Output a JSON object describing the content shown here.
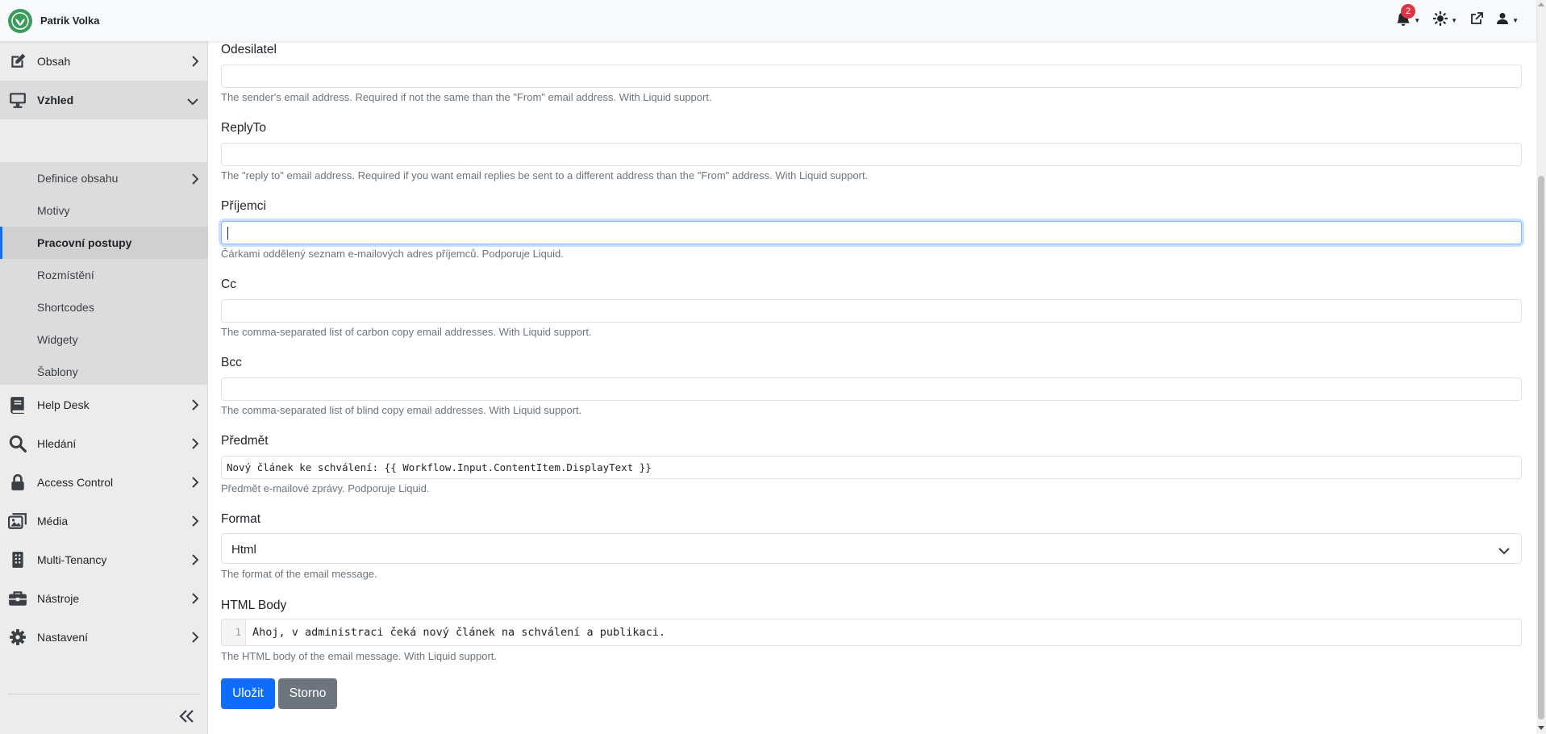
{
  "header": {
    "brand_name": "Patrik Volka",
    "notification_count": "2",
    "icons": [
      "bell-icon",
      "theme-sun-icon",
      "external-link-icon",
      "user-icon"
    ],
    "brand_color": "#3a9b5c"
  },
  "sidebar": {
    "items": [
      {
        "label": "Obsah",
        "icon": "edit-icon"
      },
      {
        "label": "Vzhled",
        "icon": "monitor-icon"
      },
      {
        "label": "Help Desk",
        "icon": "book-icon"
      },
      {
        "label": "Hledání",
        "icon": "search-icon"
      },
      {
        "label": "Access Control",
        "icon": "lock-icon"
      },
      {
        "label": "Média",
        "icon": "images-icon"
      },
      {
        "label": "Multi-Tenancy",
        "icon": "building-icon"
      },
      {
        "label": "Nástroje",
        "icon": "toolbox-icon"
      },
      {
        "label": "Nastavení",
        "icon": "cog-icon"
      }
    ],
    "sub_items": [
      {
        "label": "Definice obsahu"
      },
      {
        "label": "Motivy"
      },
      {
        "label": "Pracovní postupy"
      },
      {
        "label": "Rozmístění"
      },
      {
        "label": "Shortcodes"
      },
      {
        "label": "Widgety"
      },
      {
        "label": "Šablony"
      }
    ],
    "collapse_icon": "double-chevron-left-icon"
  },
  "form": {
    "sender": {
      "label": "Odesilatel",
      "value": "",
      "help": "The sender's email address. Required if not the same than the \"From\" email address. With Liquid support."
    },
    "replyto": {
      "label": "ReplyTo",
      "value": "",
      "help": "The \"reply to\" email address. Required if you want email replies be sent to a different address than the \"From\" address. With Liquid support."
    },
    "recipients": {
      "label": "Příjemci",
      "value": "",
      "help": "Čárkami oddělený seznam e-mailových adres příjemců. Podporuje Liquid."
    },
    "cc": {
      "label": "Cc",
      "value": "",
      "help": "The comma-separated list of carbon copy email addresses. With Liquid support."
    },
    "bcc": {
      "label": "Bcc",
      "value": "",
      "help": "The comma-separated list of blind copy email addresses. With Liquid support."
    },
    "subject": {
      "label": "Předmět",
      "value": "Nový článek ke schválení: {{ Workflow.Input.ContentItem.DisplayText }}",
      "help": "Předmět e-mailové zprávy. Podporuje Liquid."
    },
    "format": {
      "label": "Format",
      "value": "Html",
      "help": "The format of the email message."
    },
    "body": {
      "label": "HTML Body",
      "line_number": "1",
      "value": "Ahoj, v administraci čeká nový článek na schválení a publikaci.",
      "help": "The HTML body of the email message. With Liquid support."
    },
    "save_label": "Uložit",
    "cancel_label": "Storno"
  },
  "colors": {
    "primary": "#0d6efd",
    "secondary": "#6c757d",
    "badge": "#dc3545",
    "sidebar_bg": "#ececec"
  }
}
